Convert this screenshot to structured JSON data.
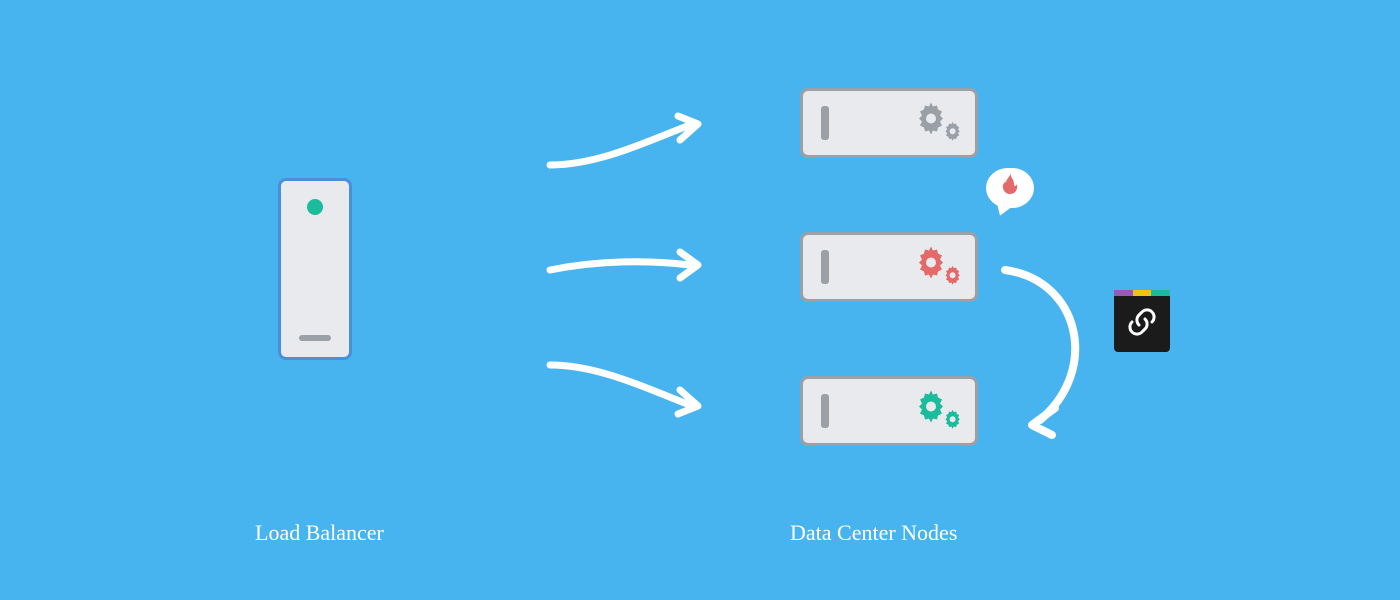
{
  "labels": {
    "load_balancer": "Load Balancer",
    "data_center": "Data Center Nodes"
  },
  "diagram": {
    "load_balancer": {
      "status_color": "#1abc9c"
    },
    "nodes": [
      {
        "state": "idle",
        "gear_color": "#9aa0a6"
      },
      {
        "state": "hot",
        "gear_color": "#e46a6a"
      },
      {
        "state": "healthy",
        "gear_color": "#1abc9c"
      }
    ],
    "failover_from_index": 1,
    "failover_to_index": 2
  },
  "colors": {
    "bg": "#48b4ef",
    "box_fill": "#e8eaed",
    "box_border_lb": "#4a90d9",
    "box_border_node": "#9aa0a6",
    "arrow": "#ffffff",
    "flame": "#e46a6a"
  }
}
